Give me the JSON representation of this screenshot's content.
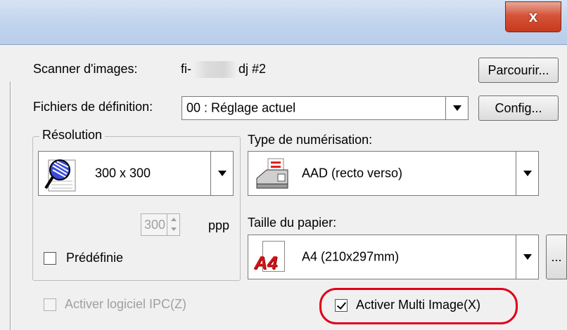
{
  "window": {
    "close_label": "x"
  },
  "scanner": {
    "label": "Scanner d'images:",
    "name_prefix": "fi-",
    "name_suffix": "dj #2",
    "browse_button": "Parcourir..."
  },
  "definition": {
    "label": "Fichiers de définition:",
    "value": "00 : Réglage actuel",
    "config_button": "Config..."
  },
  "resolution": {
    "group_title": "Résolution",
    "value": "300 x 300",
    "spin_value": "300",
    "unit": "ppp",
    "predefined_label": "Prédéfinie",
    "predefined_checked": false
  },
  "scan_type": {
    "label": "Type de numérisation:",
    "value": "AAD (recto verso)"
  },
  "paper": {
    "label": "Taille du papier:",
    "icon_text": "A4",
    "value": "A4 (210x297mm)",
    "more_button": "..."
  },
  "options": {
    "ipc_label": "Activer logiciel IPC(Z)",
    "ipc_checked": false,
    "multi_image_label": "Activer Multi Image(X)",
    "multi_image_checked": true
  },
  "colors": {
    "highlight": "#e0001b",
    "titlebar": "#c4d6ee",
    "close": "#c63a1e"
  }
}
